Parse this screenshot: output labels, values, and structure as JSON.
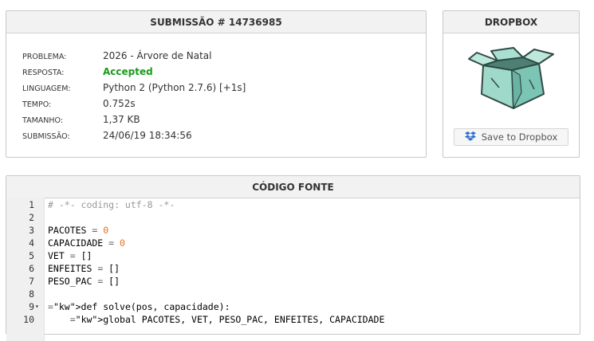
{
  "submission": {
    "header": "SUBMISSÃO # 14736985",
    "rows": [
      {
        "label": "PROBLEMA:",
        "value": "2026 - Árvore de Natal"
      },
      {
        "label": "RESPOSTA:",
        "value": "Accepted"
      },
      {
        "label": "LINGUAGEM:",
        "value": "Python 2 (Python 2.7.6) [+1s]"
      },
      {
        "label": "TEMPO:",
        "value": "0.752s"
      },
      {
        "label": "TAMANHO:",
        "value": "1,37 KB"
      },
      {
        "label": "SUBMISSÃO:",
        "value": "24/06/19 18:34:56"
      }
    ]
  },
  "dropbox": {
    "header": "DROPBOX",
    "button_label": "Save to Dropbox",
    "icon": "dropbox-logo-icon",
    "image": "open-box-illustration"
  },
  "source": {
    "header": "CÓDIGO FONTE",
    "lines": [
      {
        "n": "1",
        "text": "# -*- coding: utf-8 -*-"
      },
      {
        "n": "2",
        "text": ""
      },
      {
        "n": "3",
        "text": "PACOTES = 0"
      },
      {
        "n": "4",
        "text": "CAPACIDADE = 0"
      },
      {
        "n": "5",
        "text": "VET = []"
      },
      {
        "n": "6",
        "text": "ENFEITES = []"
      },
      {
        "n": "7",
        "text": "PESO_PAC = []"
      },
      {
        "n": "8",
        "text": ""
      },
      {
        "n": "9",
        "text": "def solve(pos, capacidade):",
        "fold": "▾"
      },
      {
        "n": "10",
        "text": "    global PACOTES, VET, PESO_PAC, ENFEITES, CAPACIDADE"
      }
    ]
  },
  "colors": {
    "accepted": "#1a9c1a",
    "number": "#e07020",
    "keyword": "#9a4ba3",
    "comment": "#999999"
  }
}
